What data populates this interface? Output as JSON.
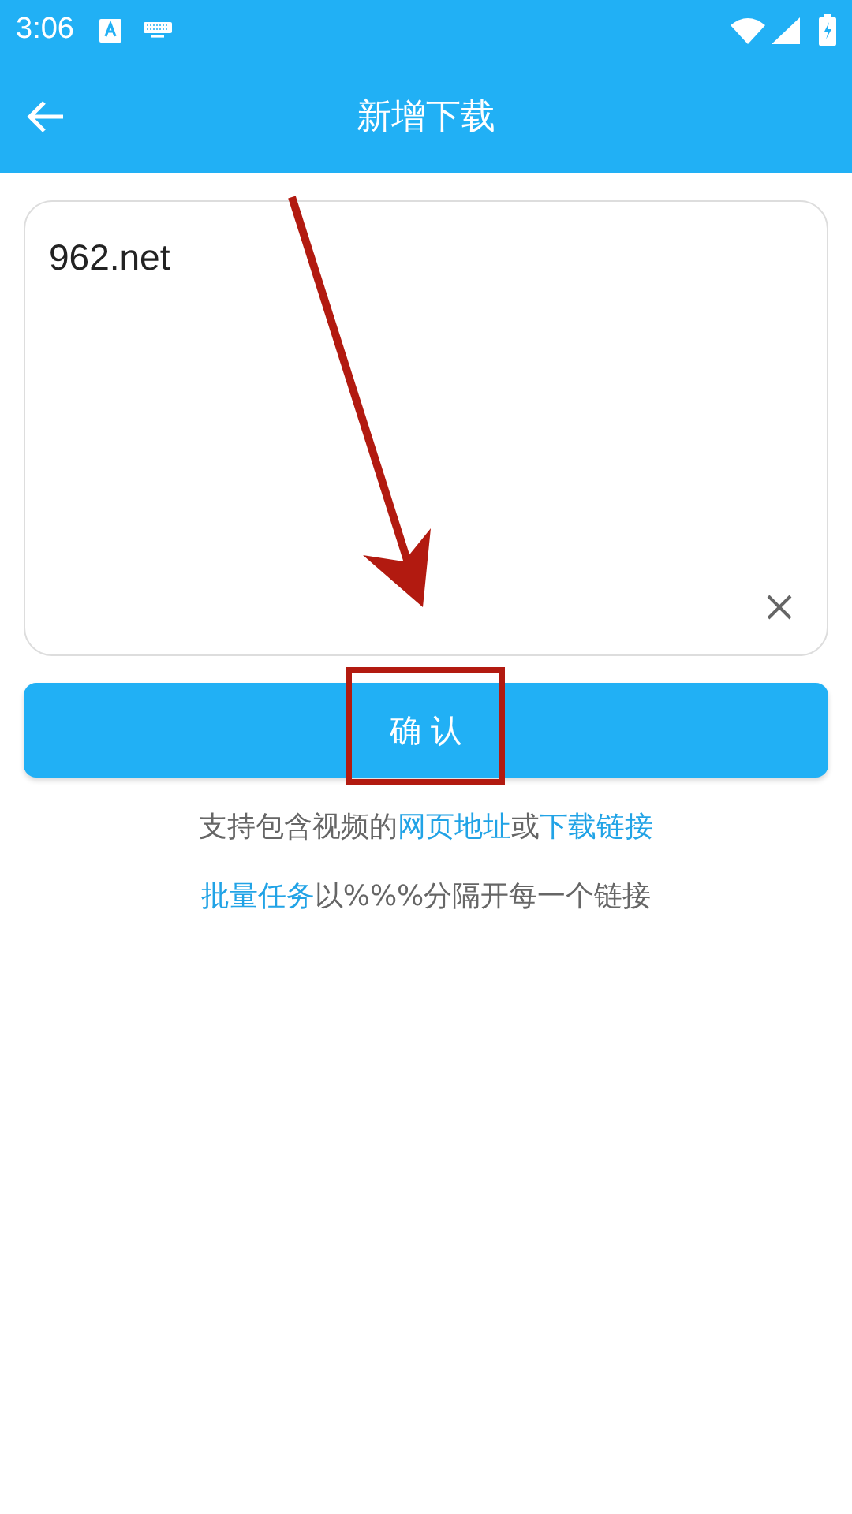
{
  "status_bar": {
    "time": "3:06"
  },
  "header": {
    "title": "新增下载"
  },
  "url_field": {
    "value": "962.net"
  },
  "confirm_button": {
    "label": "确 认"
  },
  "hints": [
    {
      "segments": [
        {
          "text": "支持包含视频的",
          "link": false
        },
        {
          "text": "网页地址",
          "link": true
        },
        {
          "text": "或",
          "link": false
        },
        {
          "text": "下载链接",
          "link": true
        }
      ]
    },
    {
      "segments": [
        {
          "text": "批量任务",
          "link": true
        },
        {
          "text": "以%%%分隔开每一个链接",
          "link": false
        }
      ]
    }
  ]
}
